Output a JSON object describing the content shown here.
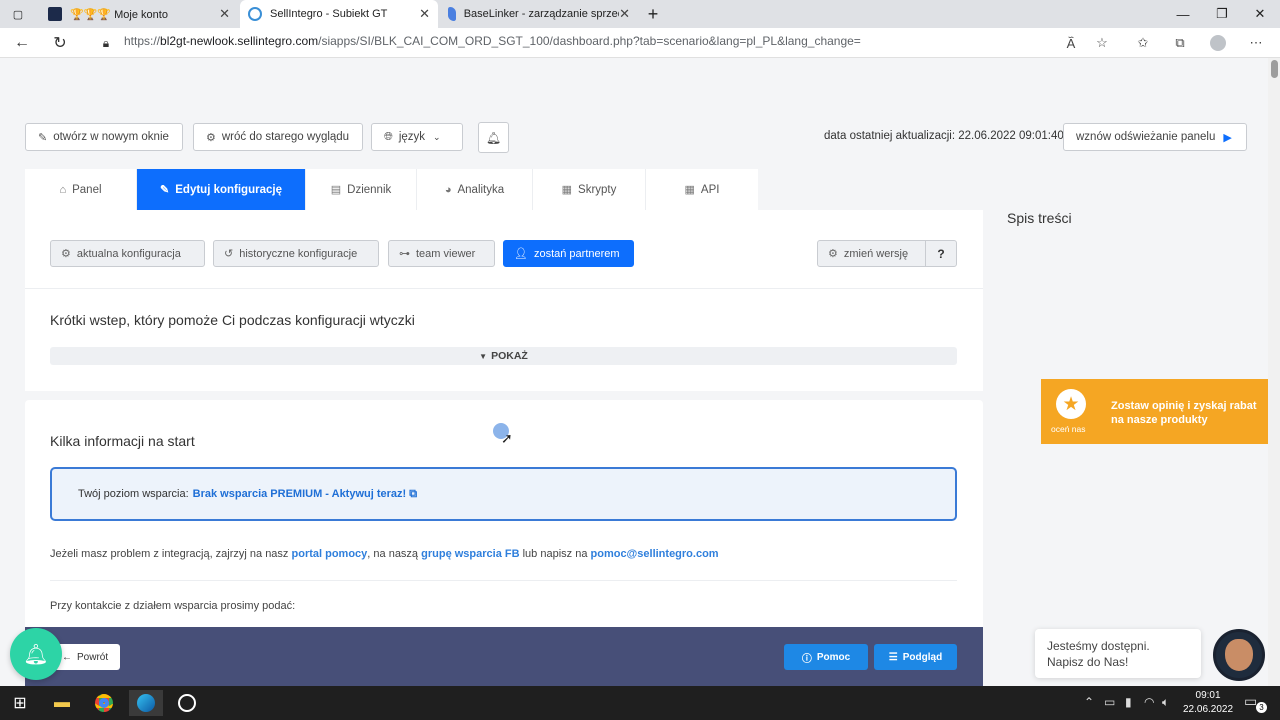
{
  "browser": {
    "tabs": [
      {
        "title": "🏆🏆🏆 Moje konto",
        "active": false
      },
      {
        "title": "SellIntegro - Subiekt GT",
        "active": true
      },
      {
        "title": "BaseLinker - zarządzanie sprzeda",
        "active": false
      }
    ],
    "url_prefix": "https://",
    "url_host": "bl2gt-newlook.sellintegro.com",
    "url_path": "/siapps/SI/BLK_CAI_COM_ORD_SGT_100/dashboard.php?tab=scenario&lang=pl_PL&lang_change="
  },
  "toolbar": {
    "open_new_window": "otwórz w nowym oknie",
    "back_old_look": "wróć do starego wyglądu",
    "language": "język",
    "last_update": "data ostatniej aktualizacji: 22.06.2022 09:01:40",
    "resume_refresh": "wznów odświeżanie panelu"
  },
  "nav_tabs": [
    {
      "label": "Panel",
      "active": false
    },
    {
      "label": "Edytuj konfigurację",
      "active": true
    },
    {
      "label": "Dziennik",
      "active": false
    },
    {
      "label": "Analityka",
      "active": false
    },
    {
      "label": "Skrypty",
      "active": false
    },
    {
      "label": "API",
      "active": false
    }
  ],
  "config_buttons": {
    "current": "aktualna konfiguracja",
    "historical": "historyczne konfiguracje",
    "team_viewer": "team viewer",
    "partner": "zostań partnerem",
    "change_version": "zmień wersję",
    "help": "?"
  },
  "intro": {
    "title": "Krótki wstep, który pomoże Ci podczas konfiguracji wtyczki",
    "show": "POKAŻ"
  },
  "start_info": {
    "title": "Kilka informacji na start",
    "support_label": "Twój poziom wsparcia:",
    "support_link": "Brak wsparcia PREMIUM - Aktywuj teraz!",
    "contact_p1": "Jeżeli masz problem z integracją, zajrzyj na nasz",
    "contact_link1": "portal pomocy",
    "contact_p2": ", na naszą",
    "contact_link2": "grupę wsparcia FB",
    "contact_p3": "lub napisz na",
    "contact_link3": "pomoc@sellintegro.com",
    "contact_note": "Przy kontakcie z działem wsparcia prosimy podać:"
  },
  "sidebar": {
    "toc_title": "Spis treści"
  },
  "rating": {
    "label": "oceń nas",
    "text": "Zostaw opinię i zyskaj rabat na nasze produkty"
  },
  "footer": {
    "back": "Powrót",
    "help": "Pomoc",
    "preview": "Podgląd"
  },
  "chat": {
    "line1": "Jesteśmy dostępni.",
    "line2": "Napisz do Nas!"
  },
  "taskbar": {
    "time": "09:01",
    "date": "22.06.2022",
    "notifications": "3"
  },
  "colors": {
    "primary": "#0d6efd",
    "rating": "#f5a623",
    "footer": "#474f78",
    "bell": "#2dd4a6"
  }
}
